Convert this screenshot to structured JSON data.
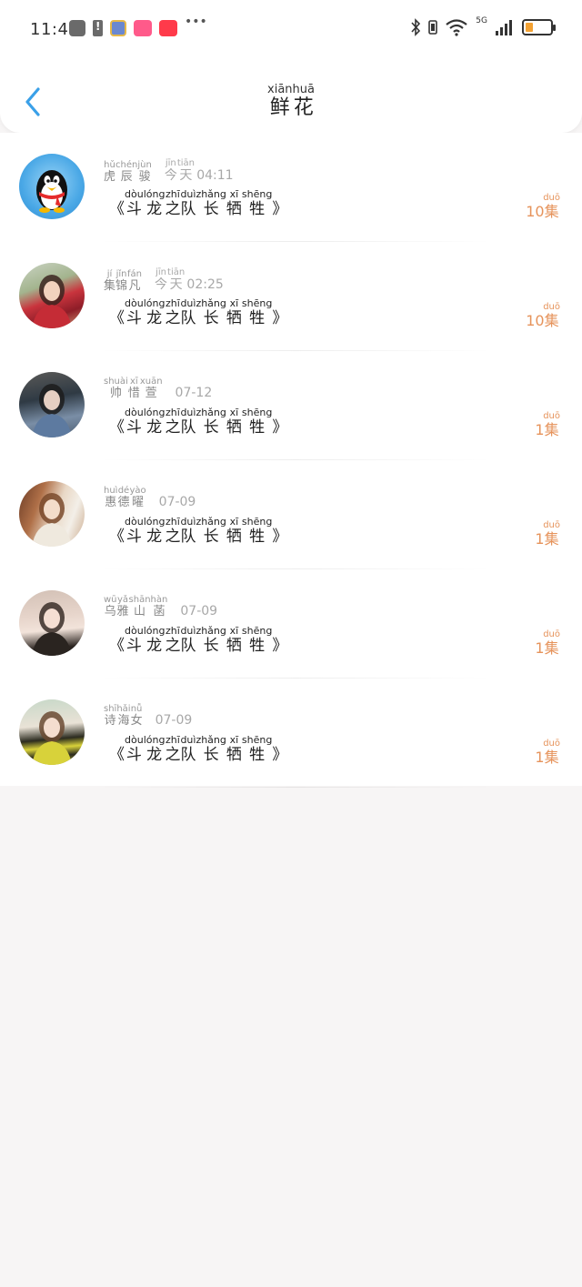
{
  "status_bar": {
    "time": "11:45",
    "network_label": "5G"
  },
  "header": {
    "title": [
      {
        "hanzi": "鲜",
        "pinyin": "xiān"
      },
      {
        "hanzi": "花",
        "pinyin": "huā"
      }
    ]
  },
  "items": [
    {
      "user": [
        {
          "hanzi": "虎",
          "pinyin": "hǔ"
        },
        {
          "hanzi": "辰",
          "pinyin": "chén"
        },
        {
          "hanzi": "骏",
          "pinyin": "jùn"
        }
      ],
      "time_ruby": [
        {
          "hanzi": "今",
          "pinyin": "jīn"
        },
        {
          "hanzi": "天",
          "pinyin": "tiān"
        }
      ],
      "time_text": "04:11",
      "title": [
        {
          "hanzi": "《",
          "pinyin": ""
        },
        {
          "hanzi": "斗",
          "pinyin": "dòu"
        },
        {
          "hanzi": "龙",
          "pinyin": "lóng"
        },
        {
          "hanzi": "之",
          "pinyin": "zhī"
        },
        {
          "hanzi": "队",
          "pinyin": "duì"
        },
        {
          "hanzi": "长",
          "pinyin": "zhǎng"
        },
        {
          "hanzi": "牺",
          "pinyin": "xī"
        },
        {
          "hanzi": "牲",
          "pinyin": "shēng"
        },
        {
          "hanzi": "》",
          "pinyin": ""
        }
      ],
      "count_number": "10",
      "count_unit": {
        "hanzi": "集",
        "pinyin": "duō"
      }
    },
    {
      "user": [
        {
          "hanzi": "集",
          "pinyin": "jí"
        },
        {
          "hanzi": "锦",
          "pinyin": "jǐn"
        },
        {
          "hanzi": "凡",
          "pinyin": "fán"
        }
      ],
      "time_ruby": [
        {
          "hanzi": "今",
          "pinyin": "jīn"
        },
        {
          "hanzi": "天",
          "pinyin": "tiān"
        }
      ],
      "time_text": "02:25",
      "title": [
        {
          "hanzi": "《",
          "pinyin": ""
        },
        {
          "hanzi": "斗",
          "pinyin": "dòu"
        },
        {
          "hanzi": "龙",
          "pinyin": "lóng"
        },
        {
          "hanzi": "之",
          "pinyin": "zhī"
        },
        {
          "hanzi": "队",
          "pinyin": "duì"
        },
        {
          "hanzi": "长",
          "pinyin": "zhǎng"
        },
        {
          "hanzi": "牺",
          "pinyin": "xī"
        },
        {
          "hanzi": "牲",
          "pinyin": "shēng"
        },
        {
          "hanzi": "》",
          "pinyin": ""
        }
      ],
      "count_number": "10",
      "count_unit": {
        "hanzi": "集",
        "pinyin": "duō"
      }
    },
    {
      "user": [
        {
          "hanzi": "帅",
          "pinyin": "shuài"
        },
        {
          "hanzi": "惜",
          "pinyin": "xī"
        },
        {
          "hanzi": "萱",
          "pinyin": "xuān"
        }
      ],
      "time_ruby": [],
      "time_text": "07-12",
      "title": [
        {
          "hanzi": "《",
          "pinyin": ""
        },
        {
          "hanzi": "斗",
          "pinyin": "dòu"
        },
        {
          "hanzi": "龙",
          "pinyin": "lóng"
        },
        {
          "hanzi": "之",
          "pinyin": "zhī"
        },
        {
          "hanzi": "队",
          "pinyin": "duì"
        },
        {
          "hanzi": "长",
          "pinyin": "zhǎng"
        },
        {
          "hanzi": "牺",
          "pinyin": "xī"
        },
        {
          "hanzi": "牲",
          "pinyin": "shēng"
        },
        {
          "hanzi": "》",
          "pinyin": ""
        }
      ],
      "count_number": "1",
      "count_unit": {
        "hanzi": "集",
        "pinyin": "duō"
      }
    },
    {
      "user": [
        {
          "hanzi": "惠",
          "pinyin": "huì"
        },
        {
          "hanzi": "德",
          "pinyin": "dé"
        },
        {
          "hanzi": "曜",
          "pinyin": "yào"
        }
      ],
      "time_ruby": [],
      "time_text": "07-09",
      "title": [
        {
          "hanzi": "《",
          "pinyin": ""
        },
        {
          "hanzi": "斗",
          "pinyin": "dòu"
        },
        {
          "hanzi": "龙",
          "pinyin": "lóng"
        },
        {
          "hanzi": "之",
          "pinyin": "zhī"
        },
        {
          "hanzi": "队",
          "pinyin": "duì"
        },
        {
          "hanzi": "长",
          "pinyin": "zhǎng"
        },
        {
          "hanzi": "牺",
          "pinyin": "xī"
        },
        {
          "hanzi": "牲",
          "pinyin": "shēng"
        },
        {
          "hanzi": "》",
          "pinyin": ""
        }
      ],
      "count_number": "1",
      "count_unit": {
        "hanzi": "集",
        "pinyin": "duō"
      }
    },
    {
      "user": [
        {
          "hanzi": "乌",
          "pinyin": "wū"
        },
        {
          "hanzi": "雅",
          "pinyin": "yǎ"
        },
        {
          "hanzi": "山",
          "pinyin": "shān"
        },
        {
          "hanzi": "菡",
          "pinyin": "hàn"
        }
      ],
      "time_ruby": [],
      "time_text": "07-09",
      "title": [
        {
          "hanzi": "《",
          "pinyin": ""
        },
        {
          "hanzi": "斗",
          "pinyin": "dòu"
        },
        {
          "hanzi": "龙",
          "pinyin": "lóng"
        },
        {
          "hanzi": "之",
          "pinyin": "zhī"
        },
        {
          "hanzi": "队",
          "pinyin": "duì"
        },
        {
          "hanzi": "长",
          "pinyin": "zhǎng"
        },
        {
          "hanzi": "牺",
          "pinyin": "xī"
        },
        {
          "hanzi": "牲",
          "pinyin": "shēng"
        },
        {
          "hanzi": "》",
          "pinyin": ""
        }
      ],
      "count_number": "1",
      "count_unit": {
        "hanzi": "集",
        "pinyin": "duō"
      }
    },
    {
      "user": [
        {
          "hanzi": "诗",
          "pinyin": "shī"
        },
        {
          "hanzi": "海",
          "pinyin": "hǎi"
        },
        {
          "hanzi": "女",
          "pinyin": "nǚ"
        }
      ],
      "time_ruby": [],
      "time_text": "07-09",
      "title": [
        {
          "hanzi": "《",
          "pinyin": ""
        },
        {
          "hanzi": "斗",
          "pinyin": "dòu"
        },
        {
          "hanzi": "龙",
          "pinyin": "lóng"
        },
        {
          "hanzi": "之",
          "pinyin": "zhī"
        },
        {
          "hanzi": "队",
          "pinyin": "duì"
        },
        {
          "hanzi": "长",
          "pinyin": "zhǎng"
        },
        {
          "hanzi": "牺",
          "pinyin": "xī"
        },
        {
          "hanzi": "牲",
          "pinyin": "shēng"
        },
        {
          "hanzi": "》",
          "pinyin": ""
        }
      ],
      "count_number": "1",
      "count_unit": {
        "hanzi": "集",
        "pinyin": "duō"
      }
    }
  ],
  "colors": {
    "accent_back": "#3aa0e8",
    "count_orange": "#e6935b",
    "page_bg": "#f7f5f5"
  },
  "icons": {
    "back": "chevron-left-icon",
    "bluetooth": "bluetooth-icon",
    "wifi": "wifi-icon",
    "signal": "signal-icon",
    "battery": "battery-icon"
  }
}
